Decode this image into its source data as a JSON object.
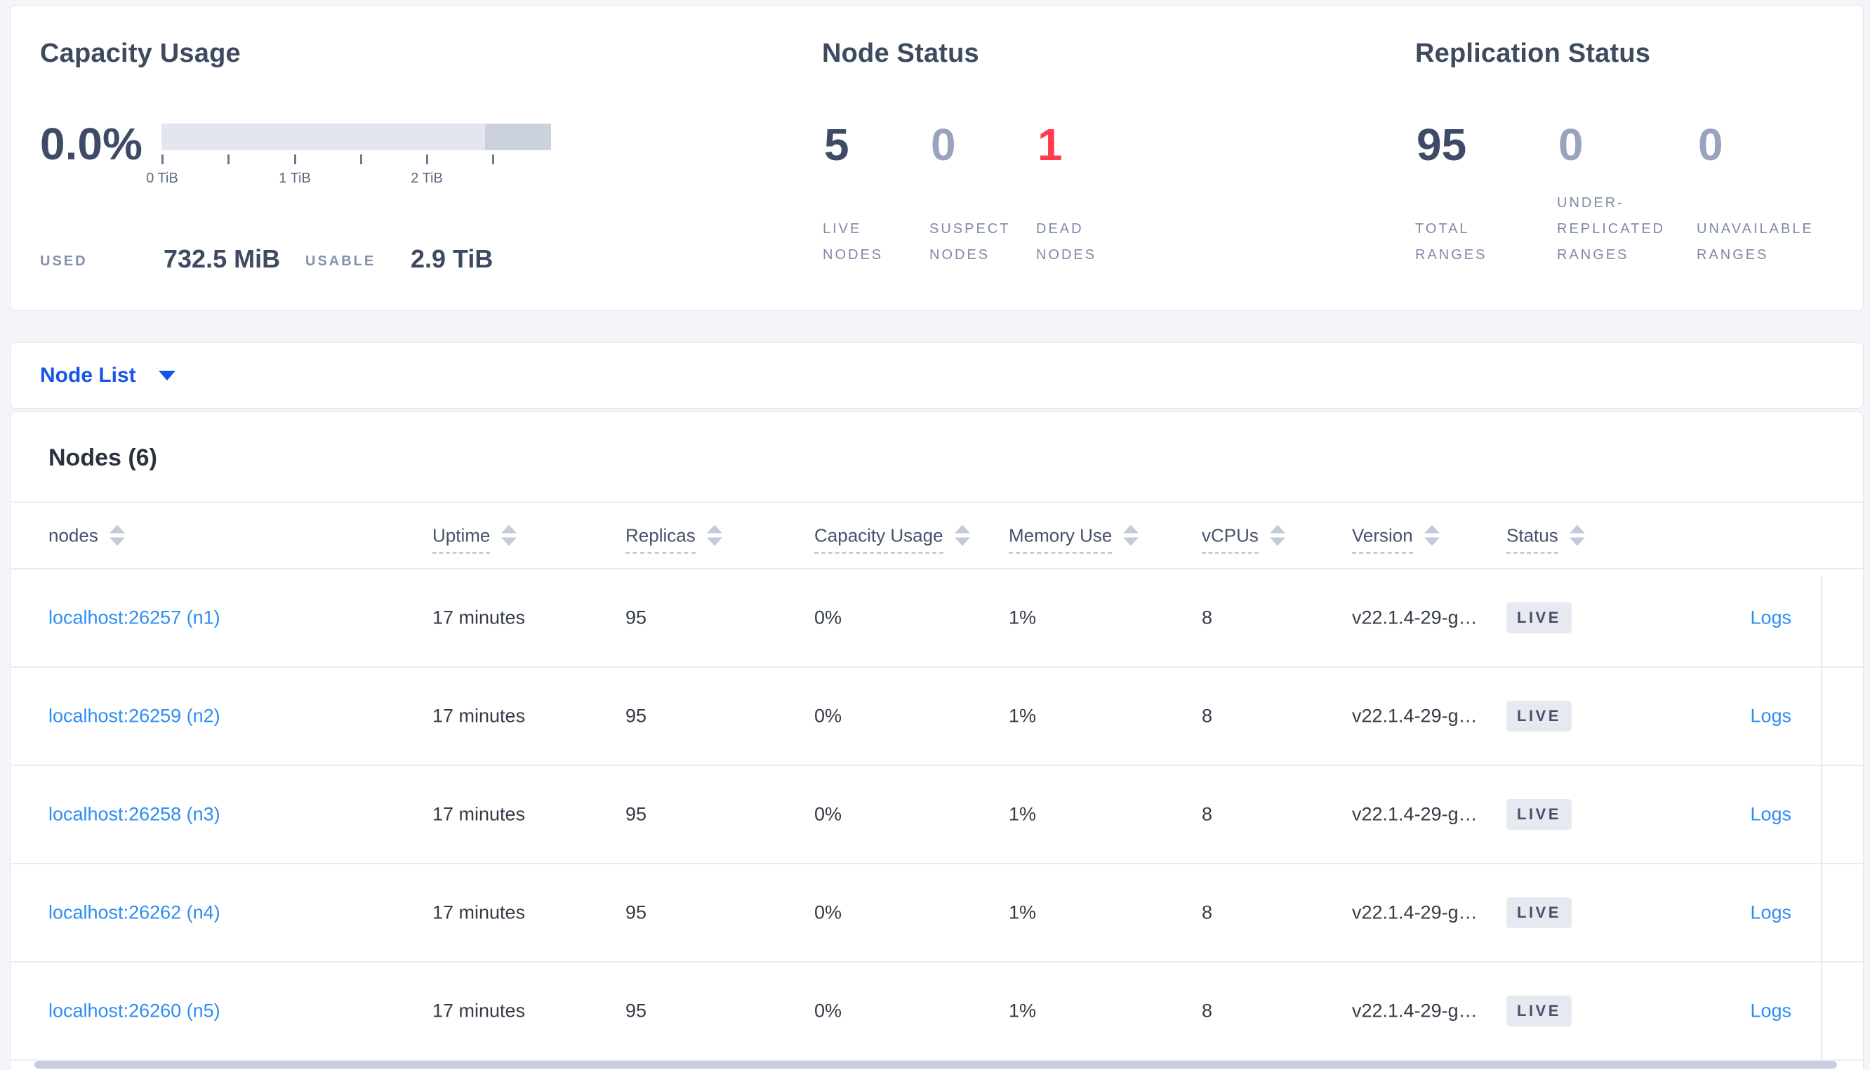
{
  "summary": {
    "capacity": {
      "title": "Capacity Usage",
      "percent": "0.0%",
      "tick_labels": [
        "0 TiB",
        "1 TiB",
        "2 TiB"
      ],
      "used_label": "USED",
      "used_value": "732.5 MiB",
      "usable_label": "USABLE",
      "usable_value": "2.9 TiB"
    },
    "node_status": {
      "title": "Node Status",
      "stats": [
        {
          "value": "5",
          "label": "LIVE NODES",
          "tone": "dark"
        },
        {
          "value": "0",
          "label": "SUSPECT NODES",
          "tone": "muted"
        },
        {
          "value": "1",
          "label": "DEAD NODES",
          "tone": "danger"
        }
      ]
    },
    "replication_status": {
      "title": "Replication Status",
      "stats": [
        {
          "value": "95",
          "label": "TOTAL RANGES",
          "tone": "dark"
        },
        {
          "value": "0",
          "label": "UNDER-REPLICATED RANGES",
          "tone": "muted"
        },
        {
          "value": "0",
          "label": "UNAVAILABLE RANGES",
          "tone": "muted"
        }
      ]
    }
  },
  "node_list": {
    "label": "Node List"
  },
  "nodes_table": {
    "title": "Nodes (6)",
    "columns": [
      {
        "label": "nodes",
        "dashed": false
      },
      {
        "label": "Uptime",
        "dashed": true
      },
      {
        "label": "Replicas",
        "dashed": true
      },
      {
        "label": "Capacity Usage",
        "dashed": true
      },
      {
        "label": "Memory Use",
        "dashed": true
      },
      {
        "label": "vCPUs",
        "dashed": true
      },
      {
        "label": "Version",
        "dashed": true
      },
      {
        "label": "Status",
        "dashed": true
      }
    ],
    "logs_label": "Logs",
    "rows": [
      {
        "node": "localhost:26257 (n1)",
        "uptime": "17 minutes",
        "replicas": "95",
        "capacity_usage": "0%",
        "memory_use": "1%",
        "vcpus": "8",
        "version": "v22.1.4-29-g…",
        "status": "LIVE"
      },
      {
        "node": "localhost:26259 (n2)",
        "uptime": "17 minutes",
        "replicas": "95",
        "capacity_usage": "0%",
        "memory_use": "1%",
        "vcpus": "8",
        "version": "v22.1.4-29-g…",
        "status": "LIVE"
      },
      {
        "node": "localhost:26258 (n3)",
        "uptime": "17 minutes",
        "replicas": "95",
        "capacity_usage": "0%",
        "memory_use": "1%",
        "vcpus": "8",
        "version": "v22.1.4-29-g…",
        "status": "LIVE"
      },
      {
        "node": "localhost:26262 (n4)",
        "uptime": "17 minutes",
        "replicas": "95",
        "capacity_usage": "0%",
        "memory_use": "1%",
        "vcpus": "8",
        "version": "v22.1.4-29-g…",
        "status": "LIVE"
      },
      {
        "node": "localhost:26260 (n5)",
        "uptime": "17 minutes",
        "replicas": "95",
        "capacity_usage": "0%",
        "memory_use": "1%",
        "vcpus": "8",
        "version": "v22.1.4-29-g…",
        "status": "LIVE"
      }
    ]
  },
  "colors": {
    "accent_blue": "#1656e8",
    "link_blue": "#2c8ef2",
    "danger_red": "#ff3b4c",
    "muted_number": "#99a3be",
    "dark_number": "#3f4b66",
    "bar_light": "#e3e6ef",
    "bar_dark": "#ccd1de",
    "badge_bg": "#e6e9f0"
  }
}
